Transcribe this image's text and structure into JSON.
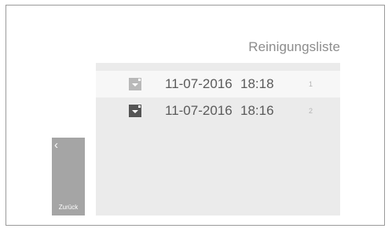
{
  "header": {
    "title": "Reinigungsliste"
  },
  "list": {
    "rows": [
      {
        "icon": "cleaning-record-icon",
        "date": "11-07-2016",
        "time": "18:18",
        "index": "1",
        "icon_color": "#b9b9b9"
      },
      {
        "icon": "cleaning-record-icon",
        "date": "11-07-2016",
        "time": "18:16",
        "index": "2",
        "icon_color": "#555555"
      }
    ]
  },
  "back_button": {
    "icon": "chevron-left-icon",
    "chevron": "‹",
    "label": "Zurück"
  },
  "colors": {
    "panel": "#ebebeb",
    "row_highlight": "#f7f7f7",
    "back_button": "#a5a5a5",
    "text": "#5a5a5a",
    "title": "#8c8c8c"
  }
}
